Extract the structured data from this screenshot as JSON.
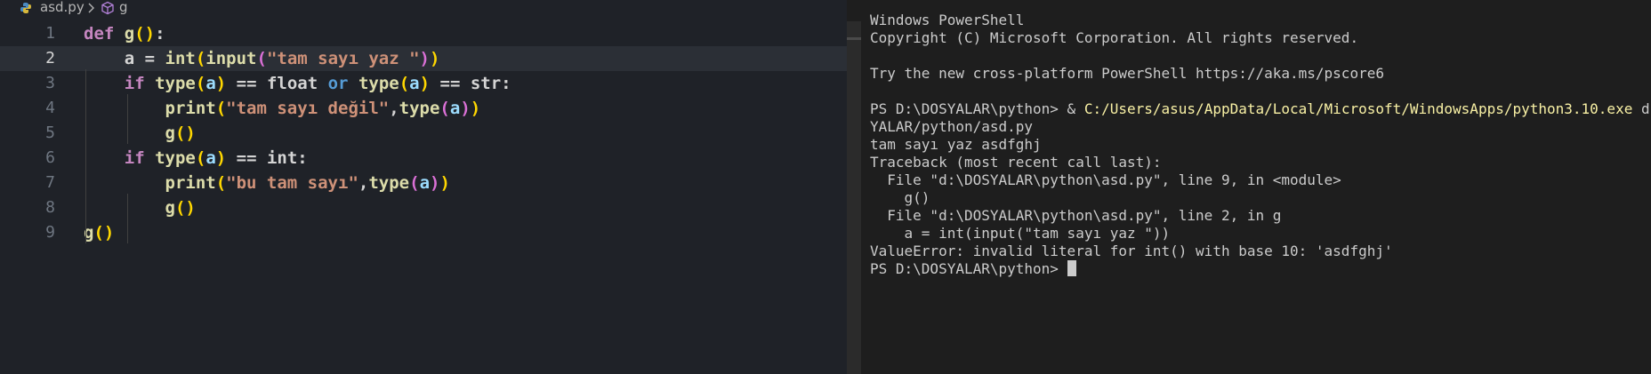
{
  "breadcrumb": {
    "file": "asd.py",
    "symbol": "g"
  },
  "editor": {
    "active_line": 2,
    "line_numbers": [
      "1",
      "2",
      "3",
      "4",
      "5",
      "6",
      "7",
      "8",
      "9"
    ],
    "lines": [
      [
        {
          "t": "def ",
          "c": "k"
        },
        {
          "t": "g",
          "c": "f"
        },
        {
          "t": "()",
          "c": "b1"
        },
        {
          "t": ":",
          "c": "v"
        }
      ],
      [
        {
          "t": "    a = ",
          "c": "v"
        },
        {
          "t": "int",
          "c": "f"
        },
        {
          "t": "(",
          "c": "b1"
        },
        {
          "t": "input",
          "c": "f"
        },
        {
          "t": "(",
          "c": "b2"
        },
        {
          "t": "\"tam sayı yaz \"",
          "c": "s"
        },
        {
          "t": ")",
          "c": "b2"
        },
        {
          "t": ")",
          "c": "b1"
        }
      ],
      [
        {
          "t": "    ",
          "c": "v"
        },
        {
          "t": "if ",
          "c": "k"
        },
        {
          "t": "type",
          "c": "f"
        },
        {
          "t": "(",
          "c": "b1"
        },
        {
          "t": "a",
          "c": "p"
        },
        {
          "t": ")",
          "c": "b1"
        },
        {
          "t": " == float ",
          "c": "v"
        },
        {
          "t": "or ",
          "c": "kb"
        },
        {
          "t": "type",
          "c": "f"
        },
        {
          "t": "(",
          "c": "b1"
        },
        {
          "t": "a",
          "c": "p"
        },
        {
          "t": ")",
          "c": "b1"
        },
        {
          "t": " == str:",
          "c": "v"
        }
      ],
      [
        {
          "t": "        ",
          "c": "v"
        },
        {
          "t": "print",
          "c": "f"
        },
        {
          "t": "(",
          "c": "b1"
        },
        {
          "t": "\"tam sayı değil\"",
          "c": "s"
        },
        {
          "t": ",",
          "c": "v"
        },
        {
          "t": "type",
          "c": "f"
        },
        {
          "t": "(",
          "c": "b2"
        },
        {
          "t": "a",
          "c": "p"
        },
        {
          "t": ")",
          "c": "b2"
        },
        {
          "t": ")",
          "c": "b1"
        }
      ],
      [
        {
          "t": "        ",
          "c": "v"
        },
        {
          "t": "g",
          "c": "f"
        },
        {
          "t": "()",
          "c": "b1"
        }
      ],
      [
        {
          "t": "    ",
          "c": "v"
        },
        {
          "t": "if ",
          "c": "k"
        },
        {
          "t": "type",
          "c": "f"
        },
        {
          "t": "(",
          "c": "b1"
        },
        {
          "t": "a",
          "c": "p"
        },
        {
          "t": ")",
          "c": "b1"
        },
        {
          "t": " == int:",
          "c": "v"
        }
      ],
      [
        {
          "t": "        ",
          "c": "v"
        },
        {
          "t": "print",
          "c": "f"
        },
        {
          "t": "(",
          "c": "b1"
        },
        {
          "t": "\"bu tam sayı\"",
          "c": "s"
        },
        {
          "t": ",",
          "c": "v"
        },
        {
          "t": "type",
          "c": "f"
        },
        {
          "t": "(",
          "c": "b2"
        },
        {
          "t": "a",
          "c": "p"
        },
        {
          "t": ")",
          "c": "b2"
        },
        {
          "t": ")",
          "c": "b1"
        }
      ],
      [
        {
          "t": "        ",
          "c": "v"
        },
        {
          "t": "g",
          "c": "f"
        },
        {
          "t": "()",
          "c": "b1"
        }
      ],
      [
        {
          "t": "g",
          "c": "f"
        },
        {
          "t": "()",
          "c": "b1"
        }
      ]
    ]
  },
  "terminal": {
    "lines": [
      [
        {
          "t": "Windows PowerShell"
        }
      ],
      [
        {
          "t": "Copyright (C) Microsoft Corporation. All rights reserved."
        }
      ],
      [
        {
          "t": ""
        }
      ],
      [
        {
          "t": "Try the new cross-platform PowerShell https://aka.ms/pscore6"
        }
      ],
      [
        {
          "t": ""
        }
      ],
      [
        {
          "t": "PS D:\\DOSYALAR\\python> & "
        },
        {
          "t": "C:/Users/asus/AppData/Local/Microsoft/WindowsApps/python3.10.exe",
          "c": "yellow"
        },
        {
          "t": " d:/DOS"
        }
      ],
      [
        {
          "t": "YALAR/python/asd.py"
        }
      ],
      [
        {
          "t": "tam sayı yaz asdfghj"
        }
      ],
      [
        {
          "t": "Traceback (most recent call last):"
        }
      ],
      [
        {
          "t": "  File \"d:\\DOSYALAR\\python\\asd.py\", line 9, in <module>"
        }
      ],
      [
        {
          "t": "    g()"
        }
      ],
      [
        {
          "t": "  File \"d:\\DOSYALAR\\python\\asd.py\", line 2, in g"
        }
      ],
      [
        {
          "t": "    a = int(input(\"tam sayı yaz \"))"
        }
      ],
      [
        {
          "t": "ValueError: invalid literal for int() with base 10: 'asdfghj'"
        }
      ],
      [
        {
          "t": "PS D:\\DOSYALAR\\python> "
        },
        {
          "t": "",
          "c": "cursor"
        }
      ]
    ]
  },
  "icons": {
    "file_icon": "python-file-icon",
    "separator": "chevron-right-icon",
    "symbol_icon": "cube-icon"
  }
}
